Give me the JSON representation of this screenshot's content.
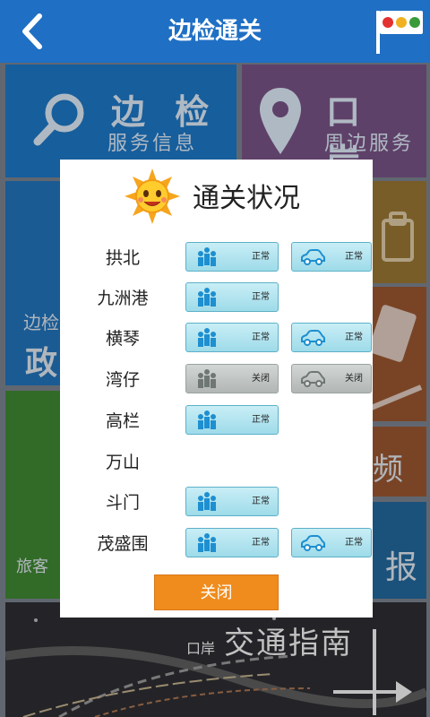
{
  "header": {
    "title": "边检通关",
    "back_icon": "chevron-left-icon",
    "flag_icon": "traffic-light-flag-icon"
  },
  "tiles": {
    "border_info": {
      "big": "边 检",
      "sub": "服务信息"
    },
    "port_nearby": {
      "big": "口 岸",
      "sub": "周边服务"
    },
    "policy": {
      "small": "边检",
      "big": "政"
    },
    "traveler": {
      "small": "旅客"
    },
    "frequency": {
      "big": "频"
    },
    "report": {
      "big": "报"
    },
    "traffic": {
      "small": "口岸",
      "big": "交通指南"
    }
  },
  "dialog": {
    "title": "通关状况",
    "rows": [
      {
        "name": "拱北",
        "passenger": "正常",
        "vehicle": "正常"
      },
      {
        "name": "九洲港",
        "passenger": "正常",
        "vehicle": null
      },
      {
        "name": "横琴",
        "passenger": "正常",
        "vehicle": "正常"
      },
      {
        "name": "湾仔",
        "passenger": "关闭",
        "vehicle": "关闭"
      },
      {
        "name": "高栏",
        "passenger": "正常",
        "vehicle": null
      },
      {
        "name": "万山",
        "passenger": null,
        "vehicle": null
      },
      {
        "name": "斗门",
        "passenger": "正常",
        "vehicle": null
      },
      {
        "name": "茂盛围",
        "passenger": "正常",
        "vehicle": "正常"
      }
    ],
    "close_label": "关闭"
  },
  "colors": {
    "header": "#1f6fc4",
    "accent": "#ef8c1d",
    "status_open": "#9edbe9",
    "status_closed": "#b1b7b4"
  }
}
